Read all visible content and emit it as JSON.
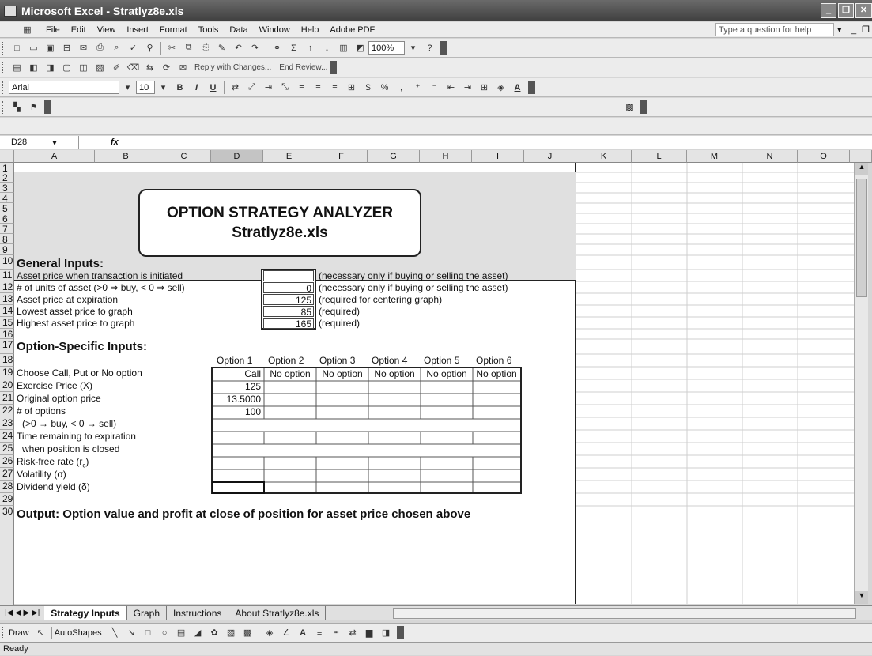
{
  "window": {
    "title": "Microsoft Excel - Stratlyz8e.xls"
  },
  "menu": [
    "File",
    "Edit",
    "View",
    "Insert",
    "Format",
    "Tools",
    "Data",
    "Window",
    "Help",
    "Adobe PDF"
  ],
  "help_box": "Type a question for help",
  "toolbar": {
    "zoom": "100%",
    "reviewing": "Reply with Changes...",
    "end_review": "End Review...",
    "font": "Arial",
    "font_size": "10"
  },
  "formula_bar": {
    "cell_ref": "D28",
    "fx": "fx",
    "value": ""
  },
  "columns": [
    "A",
    "B",
    "C",
    "D",
    "E",
    "F",
    "G",
    "H",
    "I",
    "J",
    "K",
    "L",
    "M",
    "N",
    "O"
  ],
  "rows": [
    "1",
    "2",
    "3",
    "4",
    "5",
    "6",
    "7",
    "8",
    "9",
    "10",
    "11",
    "12",
    "13",
    "14",
    "15",
    "16",
    "17",
    "18",
    "19",
    "20",
    "21",
    "22",
    "23",
    "24",
    "25",
    "26",
    "27",
    "28",
    "29",
    "30"
  ],
  "banner": {
    "title": "OPTION STRATEGY ANALYZER",
    "file": "Stratlyz8e.xls"
  },
  "general": {
    "heading": "General Inputs:",
    "rows": [
      {
        "label": "Asset price when transaction is initiated",
        "value": "",
        "note": "(necessary only if buying or selling the asset)"
      },
      {
        "label": "# of units of asset (>0 ⇒ buy, < 0 ⇒ sell)",
        "value": "0",
        "note": "(necessary only if buying or selling the asset)"
      },
      {
        "label": "Asset price at expiration",
        "value": "125",
        "note": "(required for centering graph)"
      },
      {
        "label": "Lowest asset price to graph",
        "value": "85",
        "note": "(required)"
      },
      {
        "label": "Highest asset price to graph",
        "value": "165",
        "note": "(required)"
      }
    ]
  },
  "specific": {
    "heading": "Option-Specific Inputs:",
    "options": [
      "Option 1",
      "Option 2",
      "Option 3",
      "Option 4",
      "Option 5",
      "Option 6"
    ],
    "labels": [
      "Choose Call, Put or No option",
      "Exercise Price (X)",
      "Original option price",
      "# of options",
      "(>0 → buy, < 0 → sell)",
      "Time remaining to expiration",
      "when position is closed",
      "Risk-free rate (r",
      "Volatility (σ)",
      "Dividend yield (δ)"
    ],
    "risk_sub": "c",
    "choices": [
      "Call",
      "No option",
      "No option",
      "No option",
      "No option",
      "No option"
    ],
    "exercise": "125",
    "price": "13.5000",
    "count": "100"
  },
  "output_heading": "Output:  Option value and profit at close of position  for asset price chosen above",
  "sheet_tabs": [
    "Strategy Inputs",
    "Graph",
    "Instructions",
    "About Stratlyz8e.xls"
  ],
  "draw": {
    "draw": "Draw",
    "autoshapes": "AutoShapes"
  },
  "status": "Ready"
}
